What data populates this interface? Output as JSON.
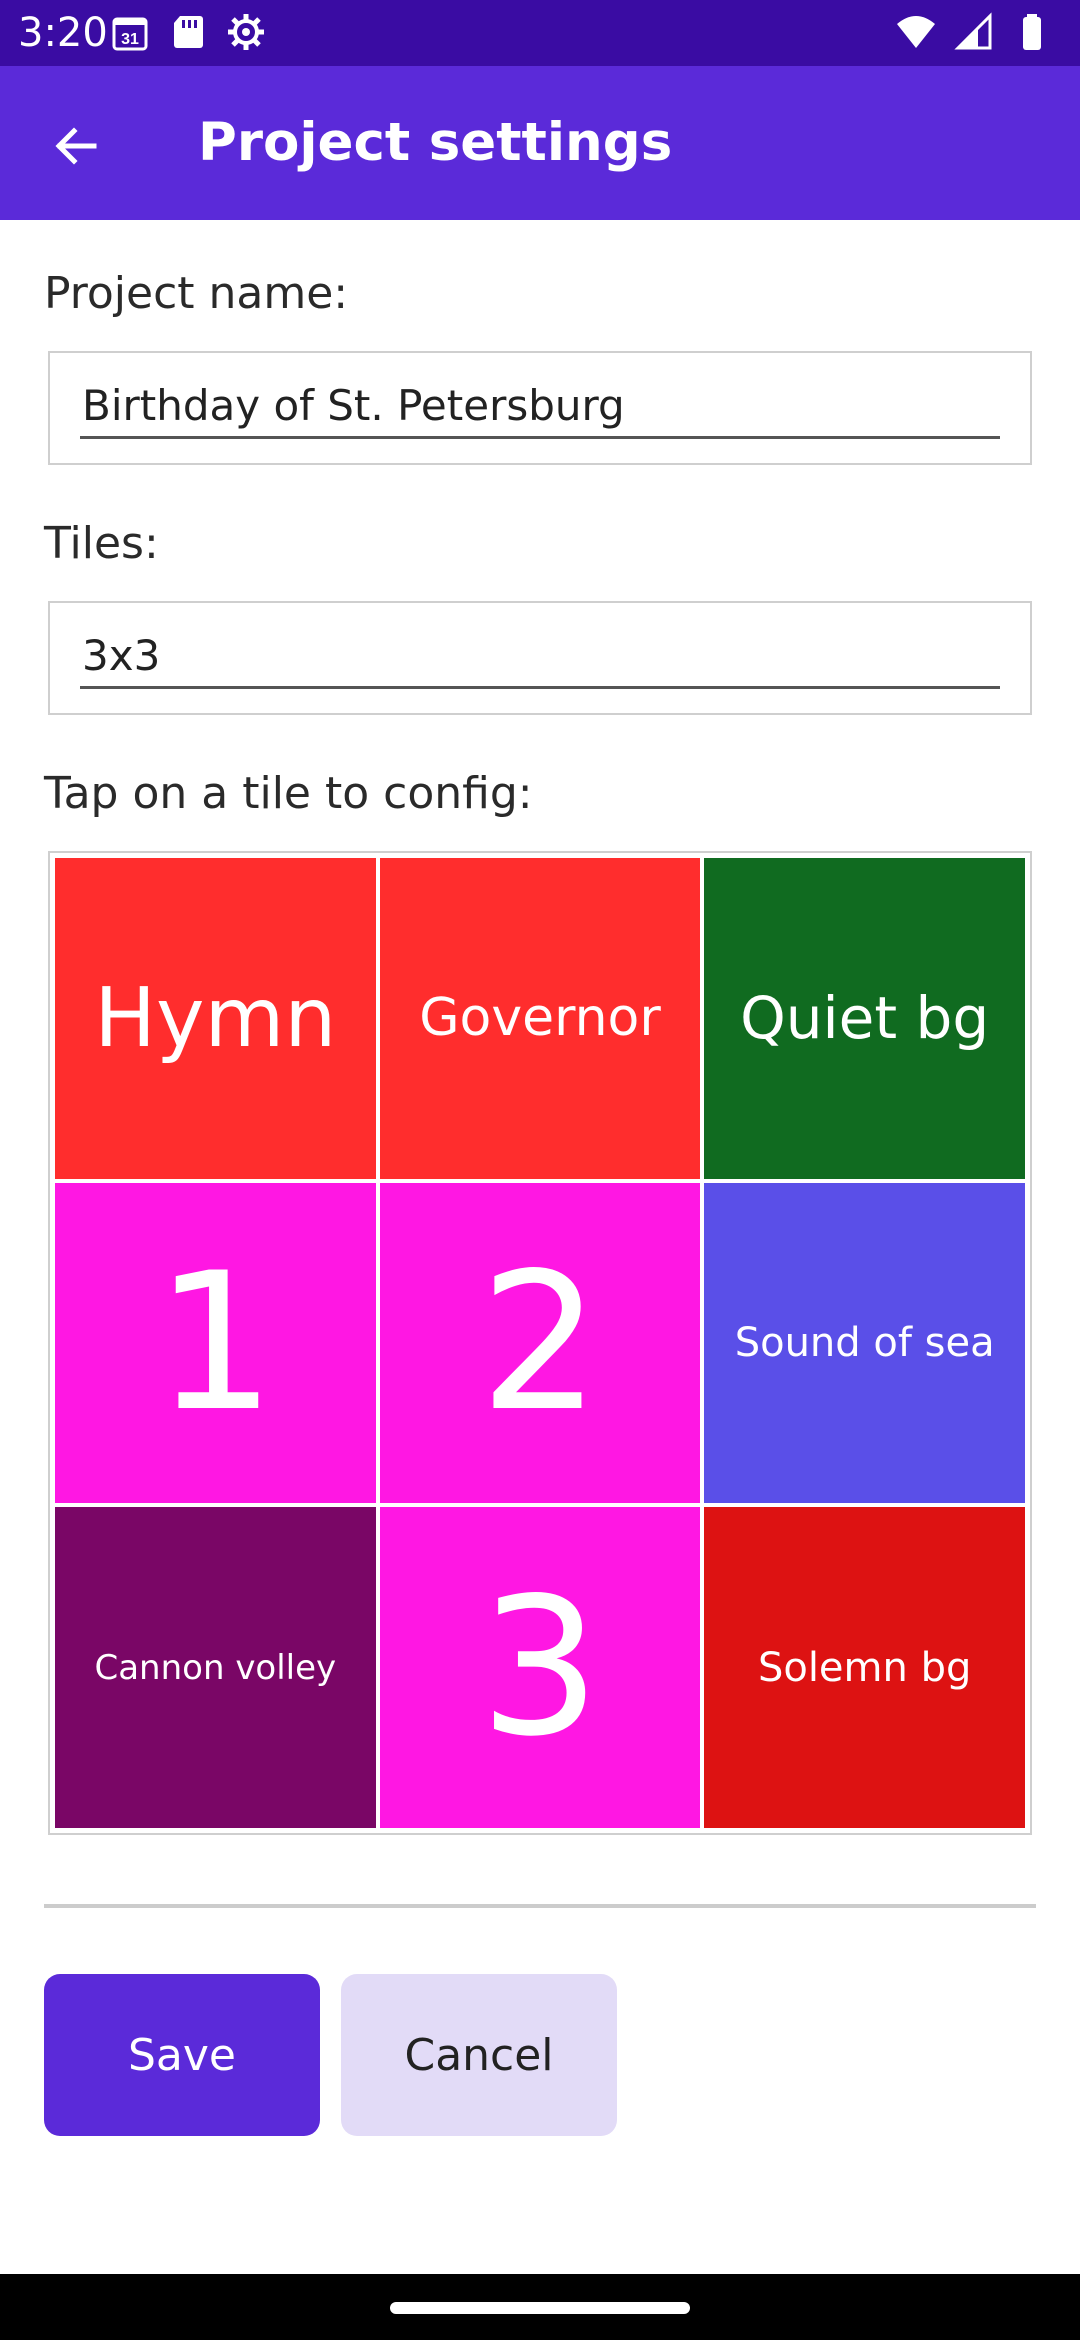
{
  "status_bar": {
    "time": "3:20",
    "calendar_day": "31",
    "left_icons": [
      "calendar-icon",
      "sd-card-icon",
      "settings-gear-icon"
    ],
    "right_icons": [
      "wifi-icon",
      "signal-icon",
      "battery-icon"
    ],
    "color": "#3a0ca3"
  },
  "app_bar": {
    "title": "Project settings",
    "back_icon": "arrow-left-icon",
    "color": "#5b2ad9"
  },
  "form": {
    "project_name_label": "Project name:",
    "project_name_value": "Birthday of St. Petersburg",
    "tiles_label": "Tiles:",
    "tiles_value": "3x3",
    "grid_label": "Tap on a tile to config:"
  },
  "tiles": [
    {
      "label": "Hymn",
      "color": "#ff2d2d"
    },
    {
      "label": "Governor",
      "color": "#ff2d2d"
    },
    {
      "label": "Quiet bg",
      "color": "#106b20"
    },
    {
      "label": "1",
      "color": "#ff17e3"
    },
    {
      "label": "2",
      "color": "#ff17e3"
    },
    {
      "label": "Sound of sea",
      "color": "#5a4fe8"
    },
    {
      "label": "Cannon volley",
      "color": "#7a0666"
    },
    {
      "label": "3",
      "color": "#ff17e3"
    },
    {
      "label": "Solemn bg",
      "color": "#dd1212"
    }
  ],
  "actions": {
    "save_label": "Save",
    "cancel_label": "Cancel",
    "save_color": "#5b2ad9",
    "cancel_color": "#e2dbf7"
  }
}
